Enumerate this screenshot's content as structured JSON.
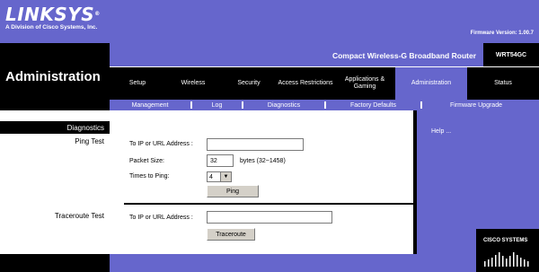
{
  "brand": {
    "logo_text": "LINKSYS",
    "registered_mark": "®",
    "subtitle": "A Division of Cisco Systems, Inc."
  },
  "firmware": "Firmware Version: 1.00.7",
  "product": {
    "name": "Compact Wireless-G Broadband Router",
    "model": "WRT54GC"
  },
  "section_title": "Administration",
  "tabs": [
    {
      "label": "Setup",
      "active": false
    },
    {
      "label": "Wireless",
      "active": false
    },
    {
      "label": "Security",
      "active": false
    },
    {
      "label": "Access Restrictions",
      "active": false
    },
    {
      "label": "Applications & Gaming",
      "active": false
    },
    {
      "label": "Administration",
      "active": true
    },
    {
      "label": "Status",
      "active": false
    }
  ],
  "subtabs": [
    "Management",
    "Log",
    "Diagnostics",
    "Factory Defaults",
    "Firmware Upgrade"
  ],
  "sidebar": {
    "section": "Diagnostics",
    "ping_label": "Ping Test",
    "traceroute_label": "Traceroute Test"
  },
  "ping": {
    "ip_label": "To IP or URL Address :",
    "ip_value": "",
    "size_label": "Packet Size:",
    "size_value": "32",
    "size_hint": "bytes (32~1458)",
    "times_label": "Times to Ping:",
    "times_value": "4",
    "button": "Ping"
  },
  "traceroute": {
    "ip_label": "To IP or URL Address :",
    "ip_value": "",
    "button": "Traceroute"
  },
  "help": {
    "link": "Help ..."
  },
  "cisco": {
    "text": "CISCO SYSTEMS"
  },
  "colors": {
    "brand_purple": "#6666cc",
    "black": "#000000"
  }
}
